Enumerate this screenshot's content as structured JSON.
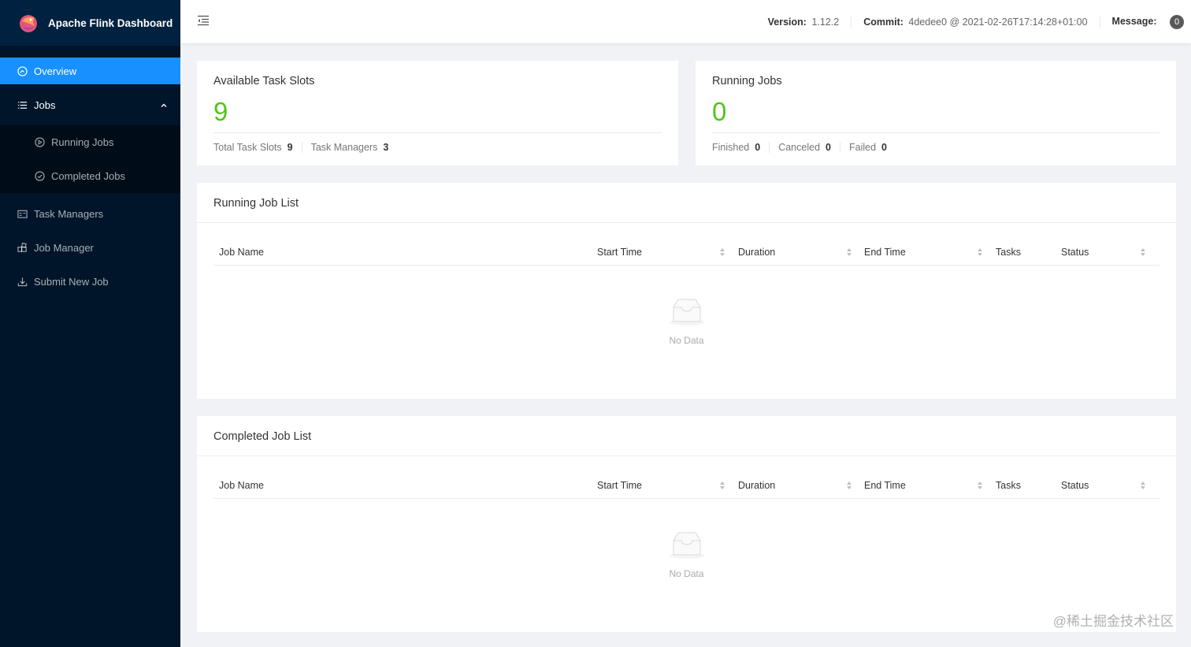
{
  "app": {
    "title": "Apache Flink Dashboard"
  },
  "sidebar": {
    "items": [
      {
        "label": "Overview",
        "icon": "dashboard-icon"
      },
      {
        "label": "Jobs",
        "icon": "list-icon"
      },
      {
        "label": "Running Jobs",
        "icon": "play-circle-icon"
      },
      {
        "label": "Completed Jobs",
        "icon": "check-circle-icon"
      },
      {
        "label": "Task Managers",
        "icon": "schedule-icon"
      },
      {
        "label": "Job Manager",
        "icon": "build-icon"
      },
      {
        "label": "Submit New Job",
        "icon": "upload-icon"
      }
    ]
  },
  "header": {
    "version_label": "Version:",
    "version": "1.12.2",
    "commit_label": "Commit:",
    "commit": "4dedee0 @ 2021-02-26T17:14:28+01:00",
    "message_label": "Message:",
    "message_count": "0"
  },
  "slots": {
    "title": "Available Task Slots",
    "value": "9",
    "total_label": "Total Task Slots",
    "total": "9",
    "tm_label": "Task Managers",
    "tm": "3"
  },
  "running": {
    "title": "Running Jobs",
    "value": "0",
    "finished_label": "Finished",
    "finished": "0",
    "canceled_label": "Canceled",
    "canceled": "0",
    "failed_label": "Failed",
    "failed": "0"
  },
  "columns": [
    "Job Name",
    "Start Time",
    "Duration",
    "End Time",
    "Tasks",
    "Status"
  ],
  "running_list": {
    "title": "Running Job List",
    "empty": "No Data"
  },
  "completed_list": {
    "title": "Completed Job List",
    "empty": "No Data"
  },
  "watermark": "@稀土掘金技术社区",
  "colors": {
    "sidebar": "#001529",
    "active": "#1890ff",
    "stat": "#52c41a"
  }
}
